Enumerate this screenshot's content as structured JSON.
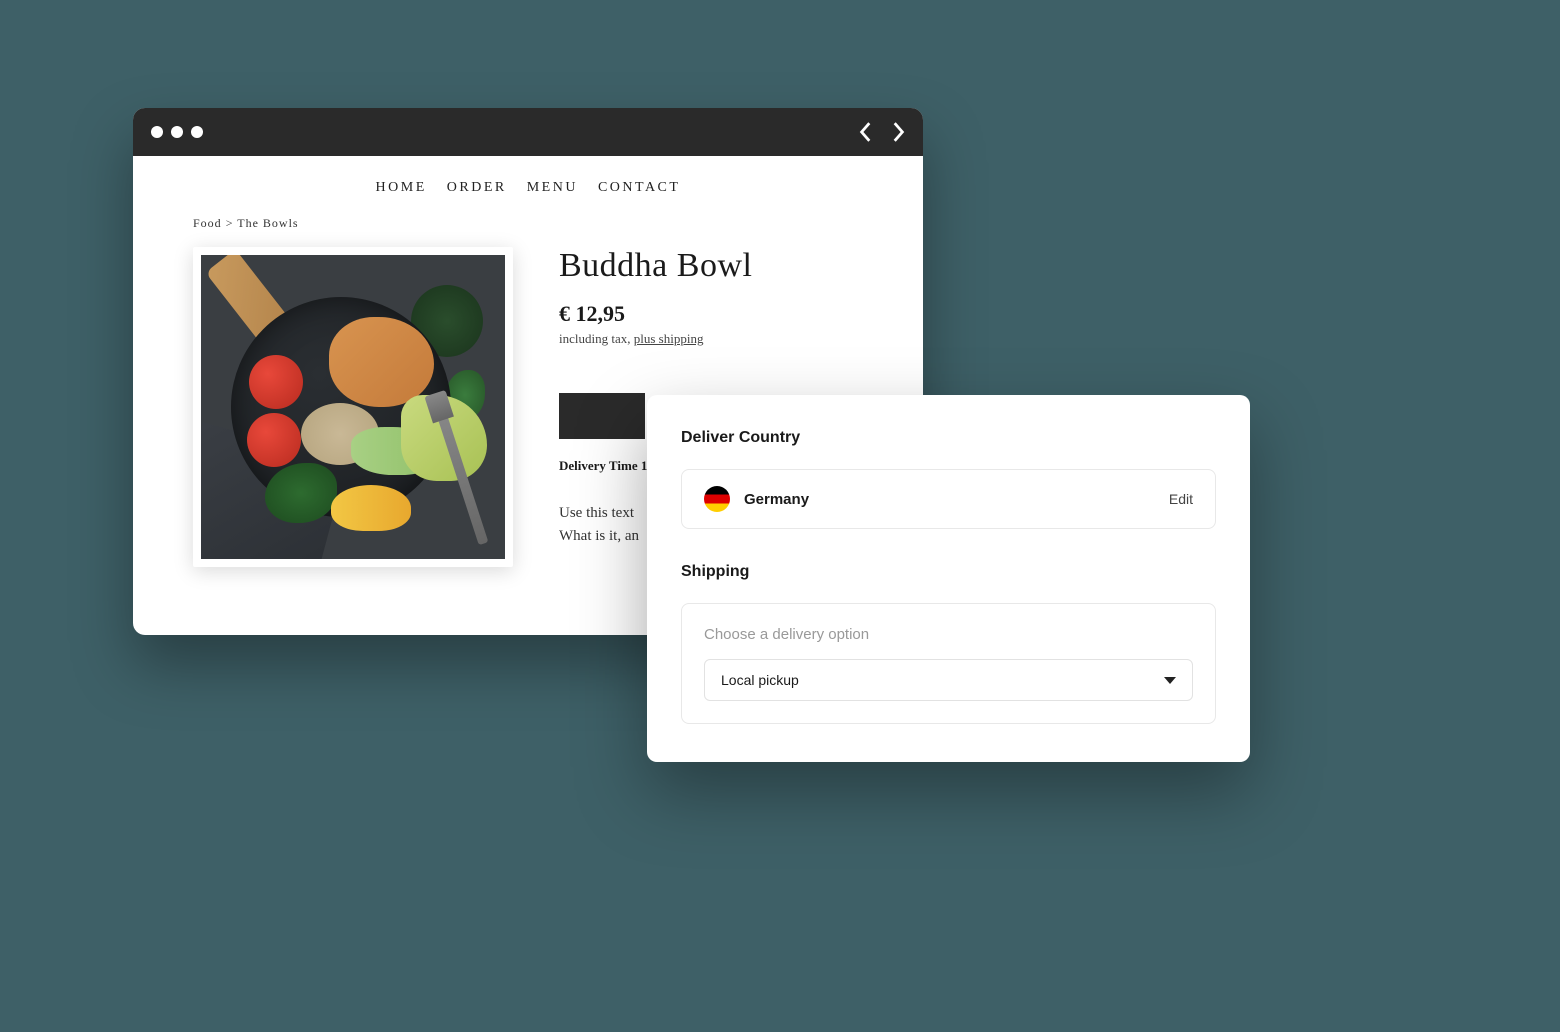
{
  "nav": {
    "items": [
      "HOME",
      "ORDER",
      "MENU",
      "CONTACT"
    ]
  },
  "breadcrumb": {
    "segment1": "Food",
    "sep": ">",
    "segment2": "The Bowls"
  },
  "product": {
    "title": "Buddha Bowl",
    "price": "€ 12,95",
    "tax_prefix": "including tax, ",
    "shipping_link": "plus shipping",
    "delivery_time": "Delivery Time 1",
    "description_l1": "Use this text",
    "description_l2": "What is it, an"
  },
  "overlay": {
    "deliver_heading": "Deliver Country",
    "country_name": "Germany",
    "edit_label": "Edit",
    "shipping_heading": "Shipping",
    "choose_label": "Choose a delivery option",
    "dropdown_value": "Local pickup"
  }
}
